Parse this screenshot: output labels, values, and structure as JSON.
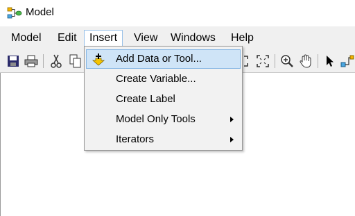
{
  "window": {
    "title": "Model"
  },
  "menubar": {
    "items": [
      {
        "label": "Model"
      },
      {
        "label": "Edit"
      },
      {
        "label": "Insert"
      },
      {
        "label": "View"
      },
      {
        "label": "Windows"
      },
      {
        "label": "Help"
      }
    ],
    "open_menu": "Insert"
  },
  "insert_menu": {
    "items": [
      {
        "label": "Add Data or Tool...",
        "icon": "add-data-icon",
        "highlighted": true,
        "submenu": false
      },
      {
        "label": "Create Variable...",
        "submenu": false
      },
      {
        "label": "Create Label",
        "submenu": false
      },
      {
        "label": "Model Only Tools",
        "submenu": true
      },
      {
        "label": "Iterators",
        "submenu": true
      }
    ]
  },
  "toolbar": {
    "icons": [
      "save-icon",
      "print-icon",
      "cut-icon",
      "copy-icon",
      "full-extent-icon",
      "zoom-in-icon",
      "pan-icon",
      "select-icon",
      "connect-icon"
    ]
  },
  "colors": {
    "menubar_bg": "#f0f0f0",
    "highlight_bg": "#cfe4f7",
    "highlight_border": "#86b6e4"
  }
}
